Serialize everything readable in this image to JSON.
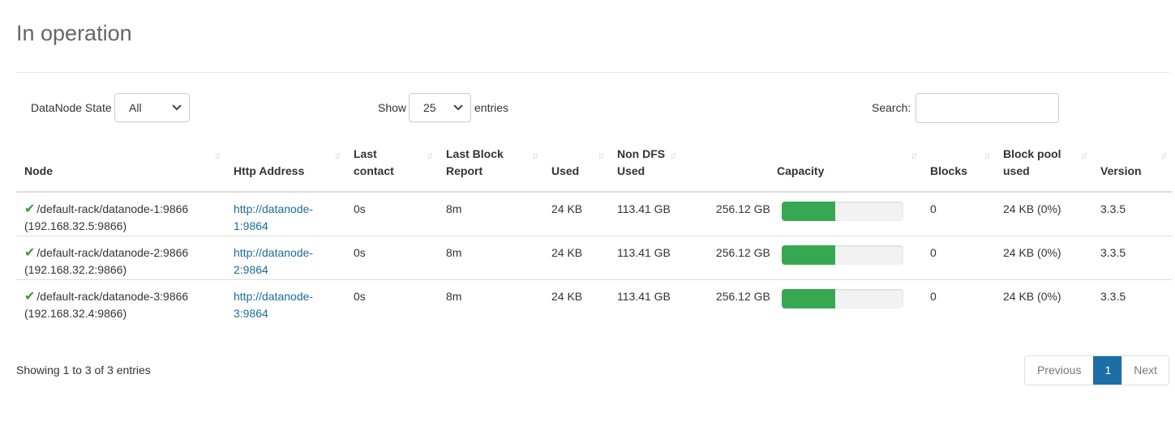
{
  "title": "In operation",
  "controls": {
    "state_label": "DataNode State",
    "state_value": "All",
    "show_label": "Show",
    "show_value": "25",
    "entries_label": "entries",
    "search_label": "Search:",
    "search_value": ""
  },
  "colors": {
    "bar_fill": "#36a852",
    "link": "#1a6d9a",
    "page_active": "#1b6fa6"
  },
  "table": {
    "headers": [
      "Node",
      "Http Address",
      "Last contact",
      "Last Block Report",
      "Used",
      "Non DFS Used",
      "Capacity",
      "Blocks",
      "Block pool used",
      "Version"
    ],
    "rows": [
      {
        "node": "/default-rack/datanode-1:9866 (192.168.32.5:9866)",
        "http": "http://datanode-1:9864",
        "last_contact": "0s",
        "last_block_report": "8m",
        "used": "24 KB",
        "non_dfs_used": "113.41 GB",
        "capacity_total": "256.12 GB",
        "capacity_fraction": 0.443,
        "blocks": "0",
        "block_pool_used": "24 KB (0%)",
        "version": "3.3.5"
      },
      {
        "node": "/default-rack/datanode-2:9866 (192.168.32.2:9866)",
        "http": "http://datanode-2:9864",
        "last_contact": "0s",
        "last_block_report": "8m",
        "used": "24 KB",
        "non_dfs_used": "113.41 GB",
        "capacity_total": "256.12 GB",
        "capacity_fraction": 0.443,
        "blocks": "0",
        "block_pool_used": "24 KB (0%)",
        "version": "3.3.5"
      },
      {
        "node": "/default-rack/datanode-3:9866 (192.168.32.4:9866)",
        "http": "http://datanode-3:9864",
        "last_contact": "0s",
        "last_block_report": "8m",
        "used": "24 KB",
        "non_dfs_used": "113.41 GB",
        "capacity_total": "256.12 GB",
        "capacity_fraction": 0.443,
        "blocks": "0",
        "block_pool_used": "24 KB (0%)",
        "version": "3.3.5"
      }
    ]
  },
  "footer": {
    "info": "Showing 1 to 3 of 3 entries",
    "previous": "Previous",
    "page": "1",
    "next": "Next"
  }
}
